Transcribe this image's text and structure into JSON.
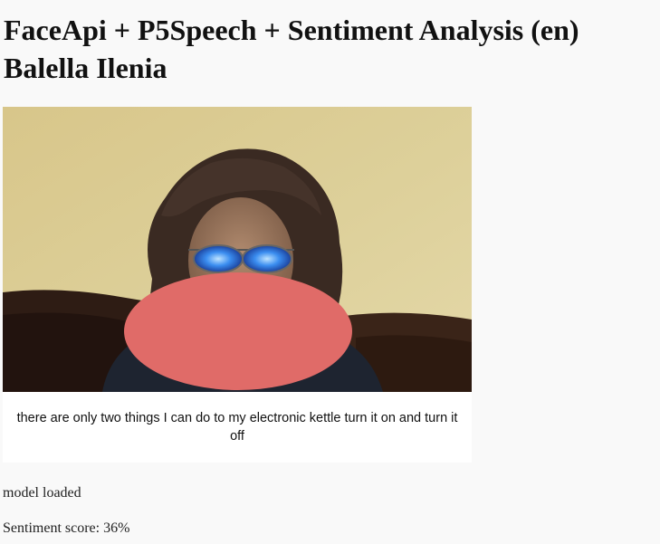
{
  "header": {
    "title_line1": "FaceApi + P5Speech + Sentiment Analysis (en)",
    "title_line2": "Balella Ilenia"
  },
  "webcam": {
    "overlay_color": "#e06b68"
  },
  "speech": {
    "transcript": "there are only two things I can do to my electronic kettle turn it on and turn it off"
  },
  "status": {
    "model_text": "model loaded",
    "sentiment_label": "Sentiment score: ",
    "sentiment_value": "36%"
  }
}
